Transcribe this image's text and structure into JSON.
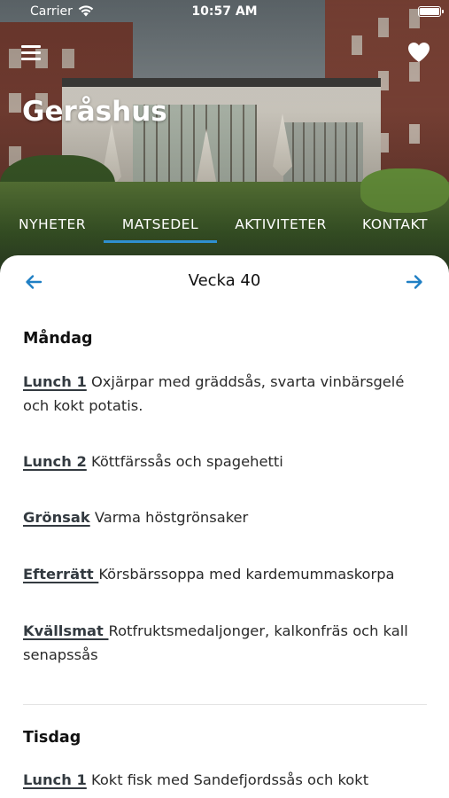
{
  "status_bar": {
    "carrier": "Carrier",
    "time": "10:57 AM"
  },
  "header": {
    "title": "Geråshus",
    "menu_icon": "hamburger-menu-icon",
    "favorite_icon": "heart-icon"
  },
  "tabs": [
    {
      "label": "NYHETER",
      "active": false
    },
    {
      "label": "MATSEDEL",
      "active": true
    },
    {
      "label": "AKTIVITETER",
      "active": false
    },
    {
      "label": "KONTAKT",
      "active": false
    }
  ],
  "accent_color": "#2f8fd0",
  "week": {
    "label": "Vecka 40",
    "prev_icon": "arrow-left-icon",
    "next_icon": "arrow-right-icon"
  },
  "days": [
    {
      "name": "Måndag",
      "meals": [
        {
          "label": "Lunch 1",
          "text": " Oxjärpar med gräddsås, svarta vinbärsgelé och kokt potatis."
        },
        {
          "label": "Lunch 2",
          "text": " Köttfärssås och spagehetti"
        },
        {
          "label": "Grönsak",
          "text": " Varma höstgrönsaker"
        },
        {
          "label": "Efterrätt ",
          "text": "Körsbärssoppa med kardemummaskorpa"
        },
        {
          "label": "Kvällsmat ",
          "text": "Rotfruktsmedaljonger, kalkonfräs och kall senapssås"
        }
      ]
    },
    {
      "name": "Tisdag",
      "meals": [
        {
          "label": "Lunch 1",
          "text": " Kokt fisk med Sandefjordssås och kokt"
        }
      ]
    }
  ]
}
